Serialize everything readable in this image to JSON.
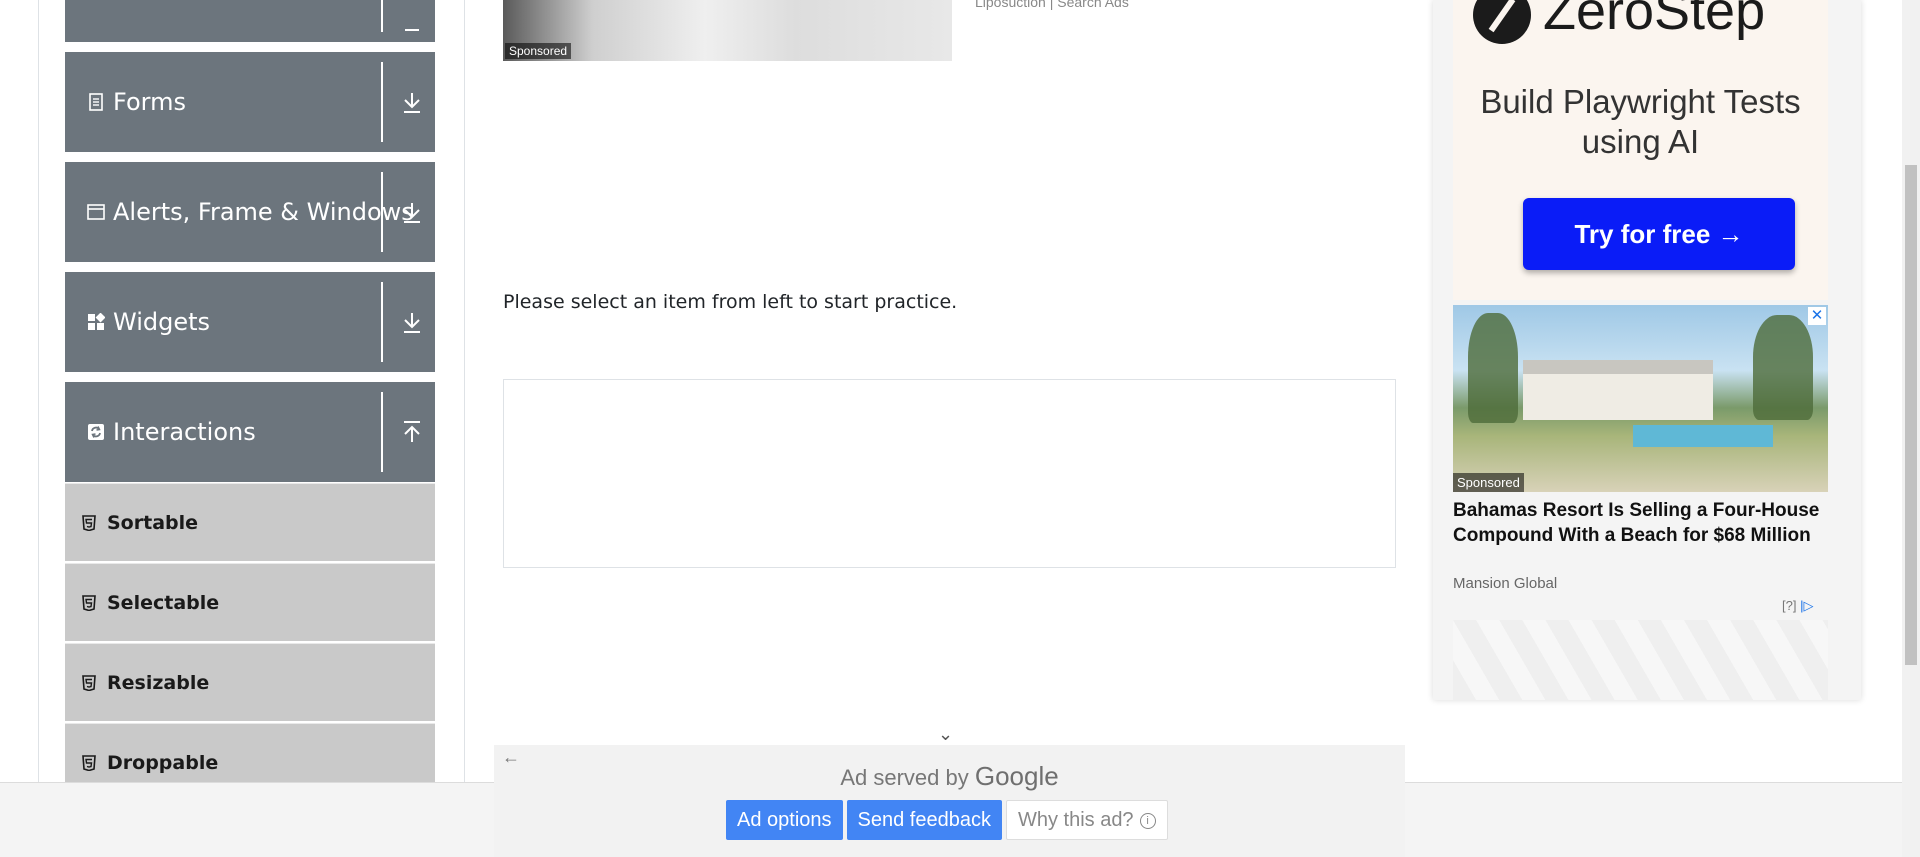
{
  "sidebar": {
    "groups": [
      {
        "label": "",
        "icon": "group-icon",
        "state": "collapsed"
      },
      {
        "label": "Forms",
        "icon": "document-icon",
        "state": "collapsed"
      },
      {
        "label": "Alerts, Frame & Windows",
        "icon": "window-icon",
        "state": "collapsed"
      },
      {
        "label": "Widgets",
        "icon": "widgets-icon",
        "state": "collapsed"
      },
      {
        "label": "Interactions",
        "icon": "sync-icon",
        "state": "expanded"
      }
    ],
    "interactions_items": [
      {
        "label": "Sortable"
      },
      {
        "label": "Selectable"
      },
      {
        "label": "Resizable"
      },
      {
        "label": "Droppable"
      }
    ]
  },
  "main": {
    "top_ad": {
      "sponsored_label": "Sponsored",
      "source": "Liposuction | Search Ads"
    },
    "practice_text": "Please select an item from left to start practice."
  },
  "right_ad": {
    "zerostep": {
      "brand": "ZeroStep",
      "headline": "Build Playwright Tests using AI",
      "cta": "Try for free →"
    },
    "bahamas": {
      "sponsored_label": "Sponsored",
      "title": "Bahamas Resort Is Selling a Four-House Compound With a Beach for $68 Million",
      "source": "Mansion Global",
      "info": "[?]"
    }
  },
  "google_ad_panel": {
    "served_by": "Ad served by",
    "google": "Google",
    "buttons": {
      "ad_options": "Ad options",
      "send_feedback": "Send feedback",
      "why_this_ad": "Why this ad?"
    }
  },
  "colors": {
    "group_bg": "#6c757d",
    "sub_bg": "#c9c9c9",
    "cta_blue": "#0a1cf7",
    "google_blue": "#4285f4"
  }
}
